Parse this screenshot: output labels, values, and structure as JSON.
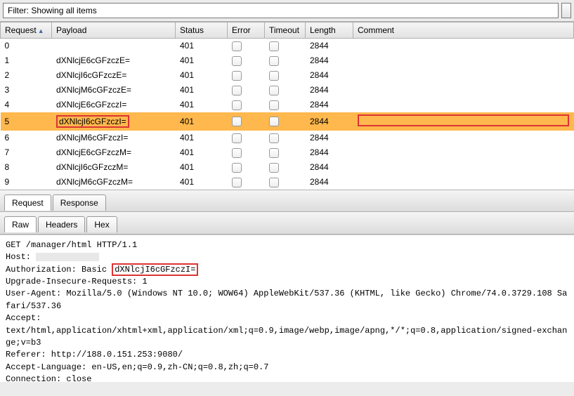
{
  "filter": {
    "text": "Filter: Showing all items"
  },
  "columns": {
    "request": "Request",
    "payload": "Payload",
    "status": "Status",
    "error": "Error",
    "timeout": "Timeout",
    "length": "Length",
    "comment": "Comment"
  },
  "rows": [
    {
      "req": "0",
      "payload": "",
      "status": "401",
      "length": "2844",
      "selected": false
    },
    {
      "req": "1",
      "payload": "dXNlcjE6cGFzczE=",
      "status": "401",
      "length": "2844",
      "selected": false
    },
    {
      "req": "2",
      "payload": "dXNlcjI6cGFzczE=",
      "status": "401",
      "length": "2844",
      "selected": false
    },
    {
      "req": "3",
      "payload": "dXNlcjM6cGFzczE=",
      "status": "401",
      "length": "2844",
      "selected": false
    },
    {
      "req": "4",
      "payload": "dXNlcjE6cGFzczI=",
      "status": "401",
      "length": "2844",
      "selected": false
    },
    {
      "req": "5",
      "payload": "dXNlcjI6cGFzczI=",
      "status": "401",
      "length": "2844",
      "selected": true
    },
    {
      "req": "6",
      "payload": "dXNlcjM6cGFzczI=",
      "status": "401",
      "length": "2844",
      "selected": false
    },
    {
      "req": "7",
      "payload": "dXNlcjE6cGFzczM=",
      "status": "401",
      "length": "2844",
      "selected": false
    },
    {
      "req": "8",
      "payload": "dXNlcjI6cGFzczM=",
      "status": "401",
      "length": "2844",
      "selected": false
    },
    {
      "req": "9",
      "payload": "dXNlcjM6cGFzczM=",
      "status": "401",
      "length": "2844",
      "selected": false
    }
  ],
  "tabs_mid": {
    "request": "Request",
    "response": "Response"
  },
  "tabs_sub": {
    "raw": "Raw",
    "headers": "Headers",
    "hex": "Hex"
  },
  "raw": {
    "line1a": "GET /manager/html HTTP/1.1",
    "host_label": "Host: ",
    "auth_prefix": "Authorization: Basic ",
    "auth_value": "dXNlcjI6cGFzczI=",
    "uir": "Upgrade-Insecure-Requests: 1",
    "ua": "User-Agent: Mozilla/5.0 (Windows NT 10.0; WOW64) AppleWebKit/537.36 (KHTML, like Gecko) Chrome/74.0.3729.108 Safari/537.36",
    "accept_label": "Accept:",
    "accept_val": "text/html,application/xhtml+xml,application/xml;q=0.9,image/webp,image/apng,*/*;q=0.8,application/signed-exchange;v=b3",
    "referer": "Referer: http://188.0.151.253:9080/",
    "lang": "Accept-Language: en-US,en;q=0.9,zh-CN;q=0.8,zh;q=0.7",
    "conn": "Connection: close"
  }
}
